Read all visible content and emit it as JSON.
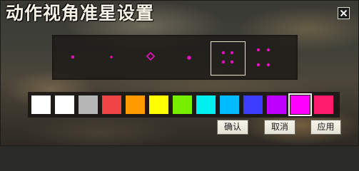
{
  "window": {
    "title": "动作视角准星设置",
    "close_icon": "close-icon"
  },
  "crosshair_options": [
    {
      "id": "small-dot",
      "icon": "single-dot-crosshair-icon"
    },
    {
      "id": "tiny-dot",
      "icon": "tiny-dot-crosshair-icon"
    },
    {
      "id": "diamond",
      "icon": "diamond-crosshair-icon"
    },
    {
      "id": "medium-dot",
      "icon": "medium-dot-crosshair-icon"
    },
    {
      "id": "four-dots-small",
      "icon": "four-dot-crosshair-icon",
      "selected": true
    },
    {
      "id": "four-dots-large",
      "icon": "wide-four-dot-crosshair-icon"
    }
  ],
  "crosshair_color": "#e012b8",
  "palette": {
    "colors": [
      "#ffffff",
      "#ffffff",
      "#b5b5b5",
      "#f04545",
      "#ff9900",
      "#ffff00",
      "#77ee00",
      "#00f0f0",
      "#00bbff",
      "#3d3dff",
      "#bb00ff",
      "#ff00ff",
      "#ff1a6e"
    ],
    "selected_index": 11
  },
  "buttons": {
    "confirm": "确认",
    "cancel": "取消",
    "apply": "应用"
  }
}
